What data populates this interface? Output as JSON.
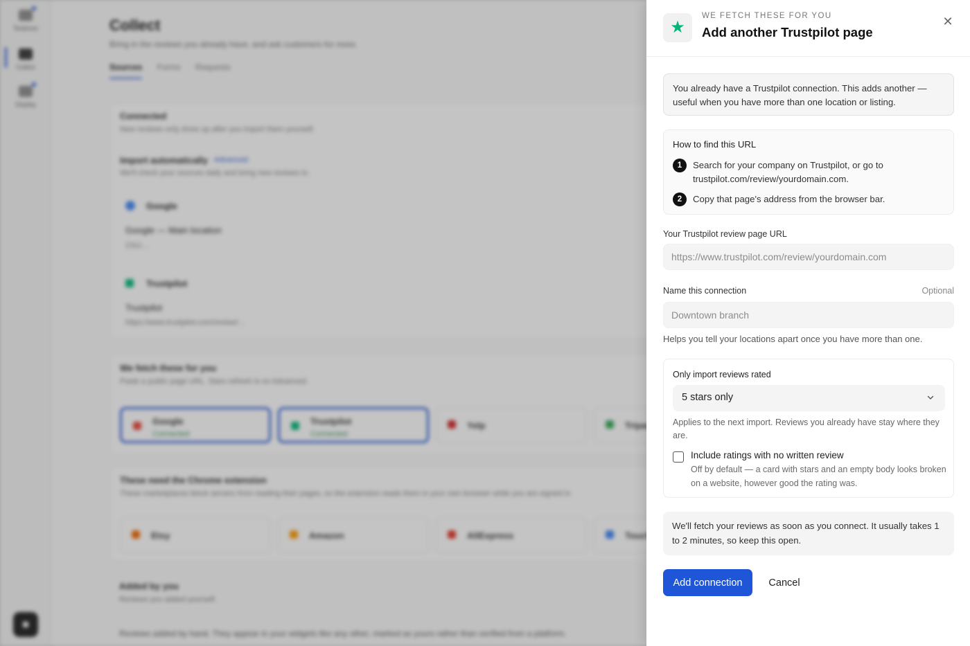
{
  "background": {
    "rail": {
      "items": [
        {
          "label": "Testimon"
        },
        {
          "label": "Collect"
        },
        {
          "label": "Display"
        }
      ]
    },
    "page_title": "Collect",
    "page_subtitle": "Bring in the reviews you already have, and ask customers for more.",
    "tabs": [
      "Sources",
      "Forms",
      "Requests"
    ],
    "connected": {
      "title": "Connected",
      "subtitle": "New reviews only show up after you import them yourself.",
      "auto_title": "Import automatically",
      "auto_badge": "Advanced",
      "auto_sub": "We'll check your sources daily and bring new reviews in.",
      "google_name": "Google",
      "google_item": "Google — Main location",
      "google_id": "ChIJ…",
      "trustpilot_name": "Trustpilot",
      "trustpilot_item": "Trustpilot",
      "trustpilot_url": "https://www.trustpilot.com/review/…"
    },
    "fetch_section": {
      "title": "We fetch these for you",
      "subtitle": "Paste a public page URL. Stars refresh is on Advanced.",
      "sources": [
        {
          "name": "Google",
          "status": "Connected",
          "color": "#e94235"
        },
        {
          "name": "Trustpilot",
          "status": "Connected",
          "color": "#00b67a"
        },
        {
          "name": "Yelp",
          "status": "",
          "color": "#d32323"
        },
        {
          "name": "Tripadvisor",
          "status": "",
          "color": "#34e0a1"
        }
      ]
    },
    "extension_section": {
      "title": "These need the Chrome extension",
      "subtitle": "These marketplaces block servers from reading their pages, so the extension reads them in your own browser while you are signed in.",
      "sources": [
        {
          "name": "Etsy",
          "color": "#f56400"
        },
        {
          "name": "Amazon",
          "color": "#ff9900"
        },
        {
          "name": "AliExpress",
          "color": "#e43225"
        },
        {
          "name": "Touch",
          "color": "#3b82f6"
        }
      ]
    },
    "added_section": {
      "title": "Added by you",
      "subtitle": "Reviews you added yourself.",
      "note": "Reviews added by hand. They appear in your widgets like any other, marked as yours rather than verified from a platform."
    }
  },
  "drawer": {
    "eyebrow": "WE FETCH THESE FOR YOU",
    "title": "Add another Trustpilot page",
    "brand_icon": "trustpilot-star-icon",
    "brand_color": "#00b67a",
    "notice": "You already have a Trustpilot connection. This adds another — useful when you have more than one location or listing.",
    "howto": {
      "title": "How to find this URL",
      "steps": [
        {
          "num": "1",
          "text": "Search for your company on Trustpilot, or go to trustpilot.com/review/yourdomain.com."
        },
        {
          "num": "2",
          "text": "Copy that page's address from the browser bar."
        }
      ]
    },
    "url_field": {
      "label": "Your Trustpilot review page URL",
      "value": "",
      "placeholder": "https://www.trustpilot.com/review/yourdomain.com"
    },
    "name_field": {
      "label": "Name this connection",
      "optional": "Optional",
      "value": "",
      "placeholder": "Downtown branch",
      "helper": "Helps you tell your locations apart once you have more than one."
    },
    "rating": {
      "label": "Only import reviews rated",
      "selected": "5 stars only",
      "help": "Applies to the next import. Reviews you already have stay where they are.",
      "checkbox_label": "Include ratings with no written review",
      "checkbox_checked": false,
      "checkbox_desc": "Off by default — a card with stars and an empty body looks broken on a website, however good the rating was."
    },
    "fetch_note": "We'll fetch your reviews as soon as you connect. It usually takes 1 to 2 minutes, so keep this open.",
    "primary_button": "Add connection",
    "cancel_button": "Cancel",
    "accent_color": "#1f56d8"
  }
}
